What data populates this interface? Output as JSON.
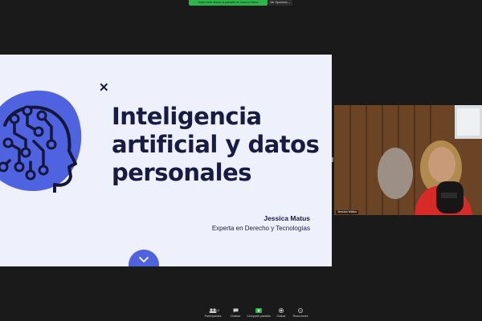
{
  "share_bar": {
    "banner_text": "Usted está viendo la pantalla de Jessica Matus",
    "options_label": "Ver Opciones ⌄"
  },
  "slide": {
    "title": "Inteligencia artificial y datos personales",
    "presenter_name": "Jessica Matus",
    "presenter_role": "Experta en Derecho y Tecnologías",
    "close_icon": "close-icon",
    "next_icon": "chevron-down-icon",
    "accent_color": "#4f63e0",
    "title_color": "#181c43"
  },
  "video": {
    "participant_name": "Jessica Matus"
  },
  "toolbar": {
    "items": [
      {
        "label": "Participantes",
        "count": "14",
        "icon": "participants-icon"
      },
      {
        "label": "Chatear",
        "icon": "chat-icon"
      },
      {
        "label": "Compartir pantalla",
        "icon": "share-screen-icon"
      },
      {
        "label": "Grabar",
        "icon": "record-icon"
      },
      {
        "label": "Reacciones",
        "icon": "reactions-icon"
      }
    ],
    "share_color": "#2fb34b"
  }
}
